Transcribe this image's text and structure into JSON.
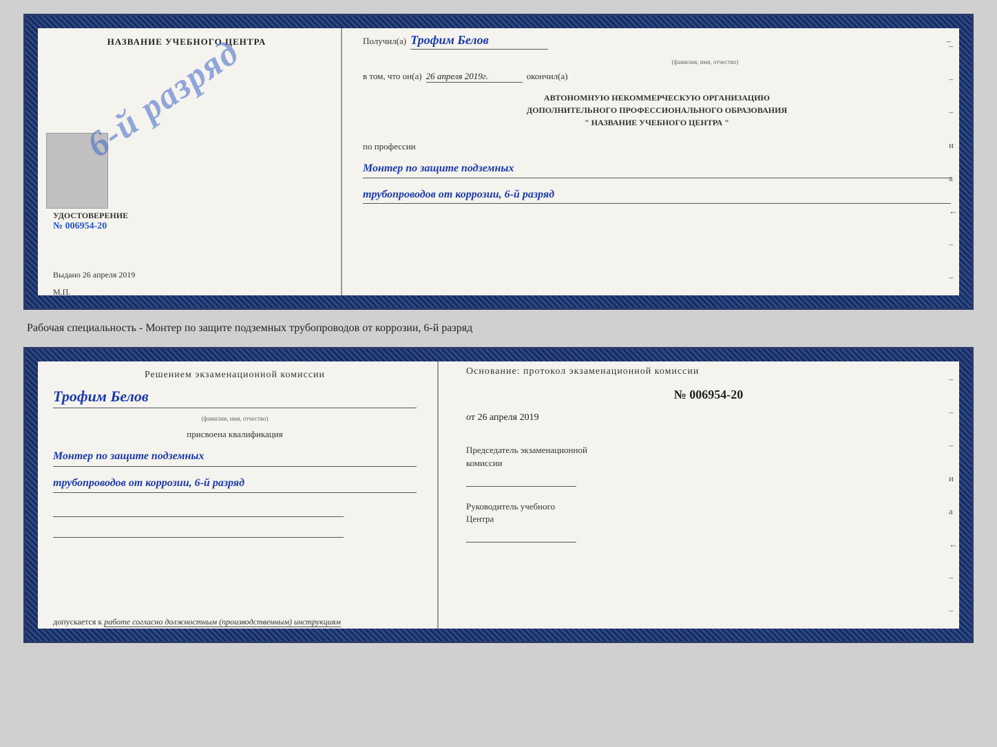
{
  "top_cert": {
    "left": {
      "title": "НАЗВАНИЕ УЧЕБНОГО ЦЕНТРА",
      "stamp_text": "6-й разряд",
      "udostoverenie_label": "УДОСТОВЕРЕНИЕ",
      "number": "№ 006954-20",
      "vydano_label": "Выдано",
      "vydano_date": "26 апреля 2019",
      "mp": "М.П."
    },
    "right": {
      "poluchil_label": "Получил(а)",
      "poluchil_name": "Трофим Белов",
      "fio_label": "(фамилия, имя, отчество)",
      "vtom_label": "в том, что он(а)",
      "vtom_date": "26 апреля 2019г.",
      "okonchill": "окончил(а)",
      "org_line1": "АВТОНОМНУЮ НЕКОММЕРЧЕСКУЮ ОРГАНИЗАЦИЮ",
      "org_line2": "ДОПОЛНИТЕЛЬНОГО ПРОФЕССИОНАЛЬНОГО ОБРАЗОВАНИЯ",
      "org_line3": "\"    НАЗВАНИЕ УЧЕБНОГО ЦЕНТРА    \"",
      "po_professii": "по профессии",
      "profession1": "Монтер по защите подземных",
      "profession2": "трубопроводов от коррозии, 6-й разряд",
      "dashes": [
        "-",
        "-",
        "-",
        "и",
        "а",
        "←",
        "-",
        "-"
      ]
    }
  },
  "middle": {
    "text": "Рабочая специальность - Монтер по защите подземных трубопроводов от коррозии, 6-й разряд"
  },
  "bottom_cert": {
    "left": {
      "resheniem": "Решением экзаменационной комиссии",
      "name": "Трофим Белов",
      "fio_label": "(фамилия, имя, отчество)",
      "prisvoena": "присвоена квалификация",
      "kval1": "Монтер по защите подземных",
      "kval2": "трубопроводов от коррозии, 6-й разряд",
      "dopuskaetsya_label": "допускается к",
      "dopuskaetsya_text": "работе согласно должностным (производственным) инструкциям"
    },
    "right": {
      "osnovanie": "Основание: протокол экзаменационной комиссии",
      "number": "№  006954-20",
      "ot_label": "от",
      "ot_date": "26 апреля 2019",
      "predsedatel_line1": "Председатель экзаменационной",
      "predsedatel_line2": "комиссии",
      "rukovoditel_line1": "Руководитель учебного",
      "rukovoditel_line2": "Центра",
      "dashes": [
        "-",
        "-",
        "-",
        "и",
        "а",
        "←",
        "-",
        "-"
      ]
    }
  }
}
